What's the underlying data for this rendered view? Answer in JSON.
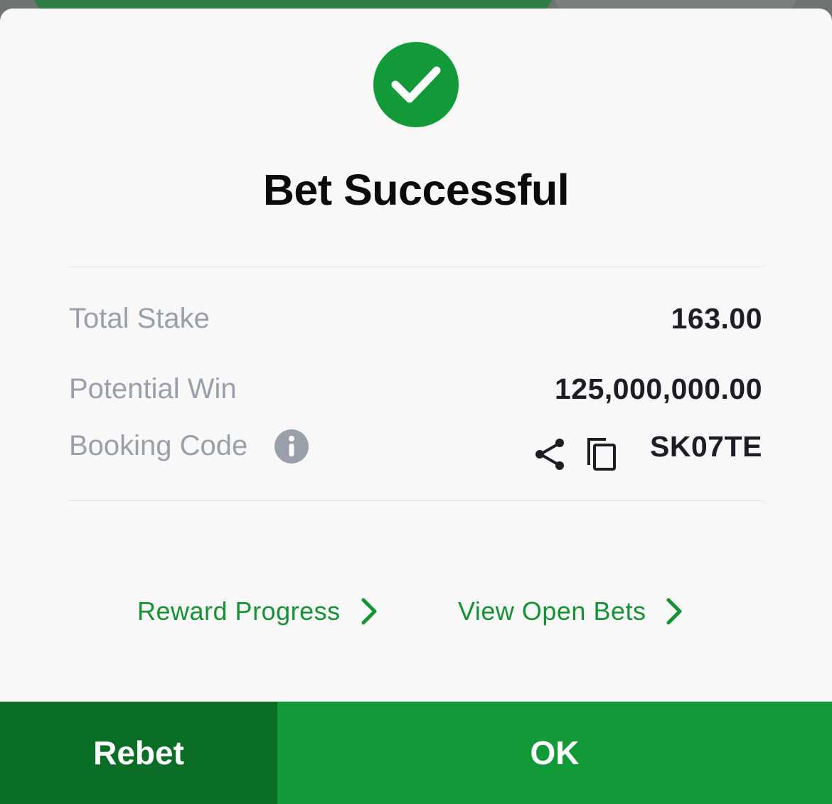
{
  "dialog": {
    "title": "Bet Successful",
    "rows": {
      "total_stake": {
        "label": "Total Stake",
        "value": "163.00"
      },
      "potential_win": {
        "label": "Potential Win",
        "value": "125,000,000.00"
      },
      "booking_code": {
        "label": "Booking Code",
        "value": "SK07TE"
      }
    },
    "links": {
      "reward_progress": "Reward Progress",
      "view_open_bets": "View Open Bets"
    },
    "buttons": {
      "rebet": "Rebet",
      "ok": "OK"
    }
  },
  "icons": {
    "success": "check-circle-icon",
    "info": "info-icon",
    "share": "share-icon",
    "copy": "copy-icon",
    "chevron": "chevron-right-icon"
  },
  "colors": {
    "brand_green": "#119a37",
    "dark_green": "#0b6e26",
    "link_green": "#149234",
    "label_gray": "#9aa0aa",
    "sheet_bg": "#f8f8f8"
  }
}
